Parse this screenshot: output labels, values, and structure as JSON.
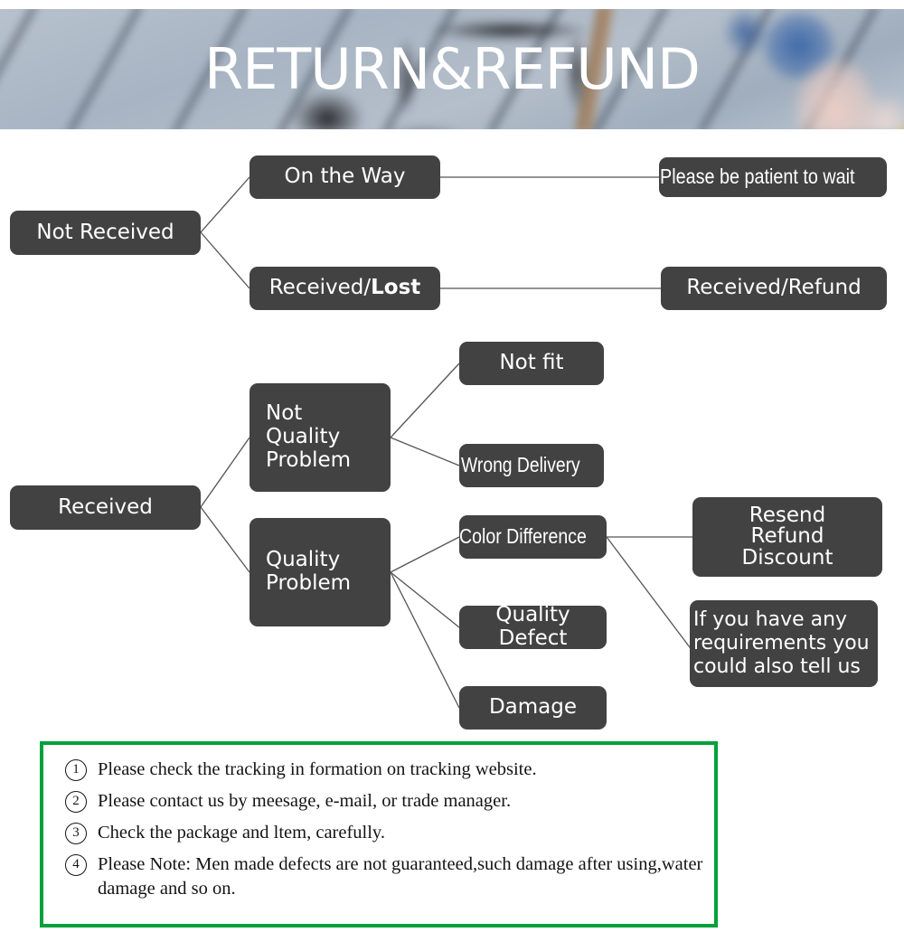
{
  "banner": {
    "title": "RETURN&REFUND"
  },
  "flowchart": {
    "nodes": {
      "not_received": "Not Received",
      "on_the_way": "On the Way",
      "received_lost_prefix": "Received/",
      "received_lost_bold": "Lost",
      "please_be_patient": "Please be patient to wait",
      "received_refund": "Received/Refund",
      "received": "Received",
      "not_quality_problem": "Not\nQuality\nProblem",
      "quality_problem": "Quality\nProblem",
      "not_fit": "Not fit",
      "wrong_delivery": "Wrong Delivery",
      "color_difference": "Color Difference",
      "quality_defect": "Quality Defect",
      "damage": "Damage",
      "resend_refund_discount": "Resend\nRefund\nDiscount",
      "requirements_note": "If you have any\nrequirements you\ncould also tell us"
    },
    "node_colors": {
      "box_fill": "#424242",
      "box_text": "#FFFFFF",
      "connector": "#555555"
    }
  },
  "notes": {
    "border_color": "#00A03C",
    "items": [
      {
        "num": "1",
        "text": "Please check the tracking in formation on tracking website."
      },
      {
        "num": "2",
        "text": "Please contact us by meesage, e-mail, or trade manager."
      },
      {
        "num": "3",
        "text": "Check the package and ltem, carefully."
      },
      {
        "num": "4",
        "text": "Please Note: Men made defects  are not guaranteed,such damage after using,water damage and so on."
      }
    ]
  }
}
